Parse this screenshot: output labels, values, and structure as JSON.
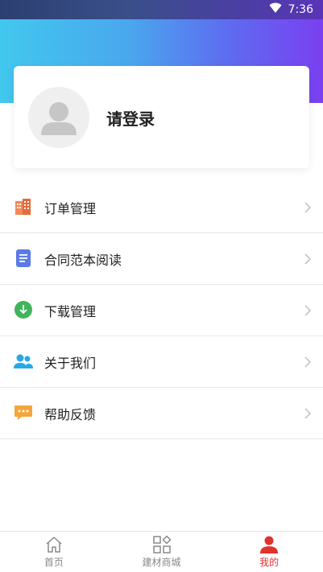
{
  "status_bar": {
    "time": "7:36",
    "wifi_icon": "wifi-icon"
  },
  "profile": {
    "login_prompt": "请登录",
    "avatar_icon": "user-avatar-icon"
  },
  "menu": {
    "items": [
      {
        "label": "订单管理",
        "icon": "building-icon",
        "color": "#ee7b4c"
      },
      {
        "label": "合同范本阅读",
        "icon": "document-icon",
        "color": "#5b7be6"
      },
      {
        "label": "下载管理",
        "icon": "download-icon",
        "color": "#3fb55b"
      },
      {
        "label": "关于我们",
        "icon": "users-icon",
        "color": "#27a9e6"
      },
      {
        "label": "帮助反馈",
        "icon": "chat-bubble-icon",
        "color": "#f4a63a"
      }
    ]
  },
  "tabbar": {
    "tabs": [
      {
        "label": "首页",
        "icon": "home-icon",
        "active": false
      },
      {
        "label": "建材商城",
        "icon": "category-grid-icon",
        "active": false
      },
      {
        "label": "我的",
        "icon": "person-icon",
        "active": true
      }
    ],
    "active_color": "#e0322f",
    "inactive_color": "#888888"
  }
}
